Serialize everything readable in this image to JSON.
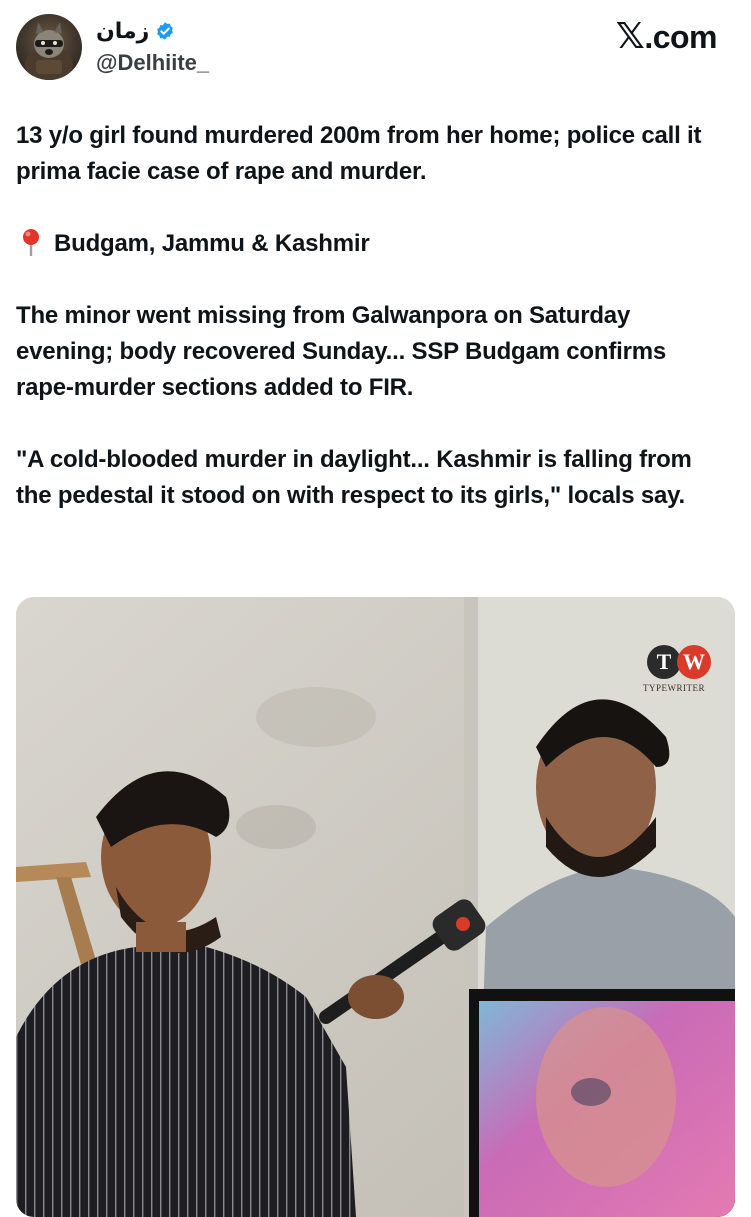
{
  "author": {
    "display_name": "زمان",
    "handle": "@Delhiite_",
    "verified": true,
    "avatar_icon": "raccoon-avatar-icon"
  },
  "brand": {
    "logo_text": ".com",
    "logo_mark": "𝕏"
  },
  "tweet": {
    "paragraphs": [
      "13 y/o girl found murdered 200m from her home; police call it prima facie case of rape and murder.",
      "Budgam, Jammu & Kashmir",
      "The minor went missing from Galwanpora on Saturday evening; body recovered Sunday... SSP Budgam confirms rape-murder sections added to FIR.",
      "\"A cold-blooded murder in daylight... Kashmir is falling from the pedestal it stood on with respect to its girls,\" locals say."
    ],
    "location_icon": "pin-icon"
  },
  "media": {
    "watermark_t": "T",
    "watermark_w": "W",
    "watermark_caption": "TYPEWRITER"
  },
  "colors": {
    "verified_blue": "#1d9bf0",
    "pin_red": "#e0352b",
    "watermark_red": "#d83a2b"
  }
}
